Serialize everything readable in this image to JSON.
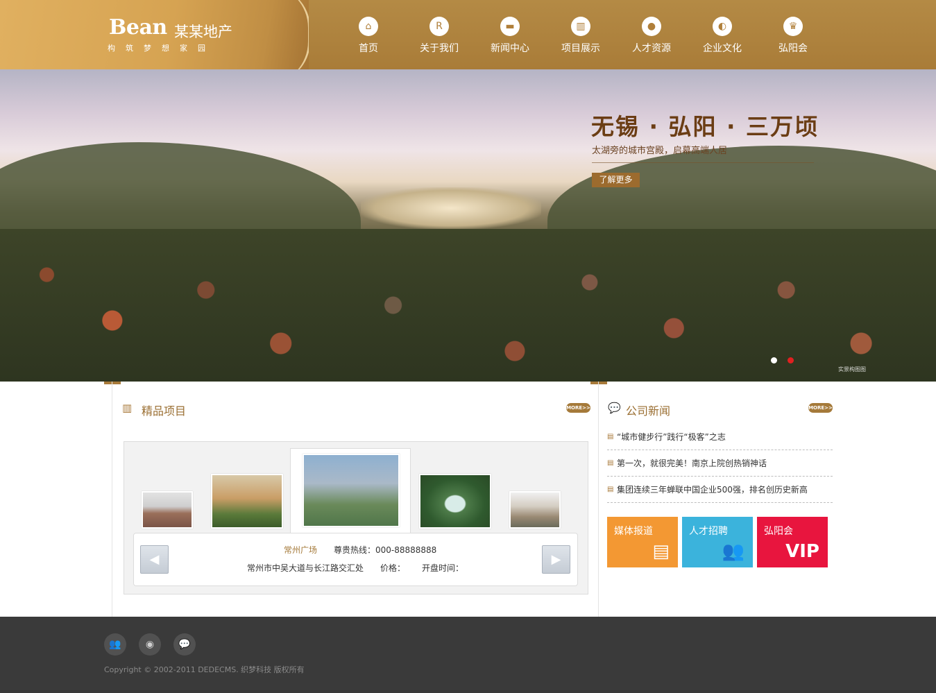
{
  "colors": {
    "brand_gold": "#a97c38",
    "footer_bg": "#3a3a3a",
    "media_tile": "#f39833",
    "hr_tile": "#3bb3dc",
    "vip_tile": "#e8153e",
    "dot_active": "#e02020"
  },
  "header": {
    "logo_en": "Bean",
    "logo_cn": "某某地产",
    "tagline": "构筑梦想家园",
    "nav": [
      {
        "label": "首页",
        "icon": "home-icon",
        "glyph": "⌂"
      },
      {
        "label": "关于我们",
        "icon": "r-logo-icon",
        "glyph": "R"
      },
      {
        "label": "新闻中心",
        "icon": "chat-bubble-icon",
        "glyph": "▬"
      },
      {
        "label": "项目展示",
        "icon": "buildings-icon",
        "glyph": "▥"
      },
      {
        "label": "人才资源",
        "icon": "people-icon",
        "glyph": "●"
      },
      {
        "label": "企业文化",
        "icon": "planet-icon",
        "glyph": "◐"
      },
      {
        "label": "弘阳会",
        "icon": "trophy-icon",
        "glyph": "♛"
      }
    ]
  },
  "banner": {
    "title": "无锡 · 弘阳 · 三万顷",
    "subtitle": "太湖旁的城市宫殿，启幕高端人居",
    "button": "了解更多",
    "watermark": "实景构图图"
  },
  "projects": {
    "title": "精品项目",
    "more": "MORE>>",
    "name": "常州广场",
    "hotline": "尊贵热线：000-88888888",
    "address": "常州市中吴大道与长江路交汇处",
    "price": "价格：",
    "open_date": "开盘时间：",
    "prev": "◀",
    "next": "▶"
  },
  "news": {
    "title": "公司新闻",
    "more": "MORE>>",
    "items": [
      "“城市健步行”践行“极客”之志",
      "第一次，就很完美！南京上院创热销神话",
      "集团连续三年蝉联中国企业500强，排名创历史新高"
    ]
  },
  "tiles": [
    {
      "label": "媒体报道",
      "glyph": "▤"
    },
    {
      "label": "人才招聘",
      "glyph": "👥"
    },
    {
      "label": "弘阳会",
      "glyph": "VIP"
    }
  ],
  "footer": {
    "icons": [
      "people-icon",
      "weibo-icon",
      "wechat-icon"
    ],
    "copyright": "Copyright © 2002-2011 DEDECMS. 织梦科技 版权所有"
  }
}
